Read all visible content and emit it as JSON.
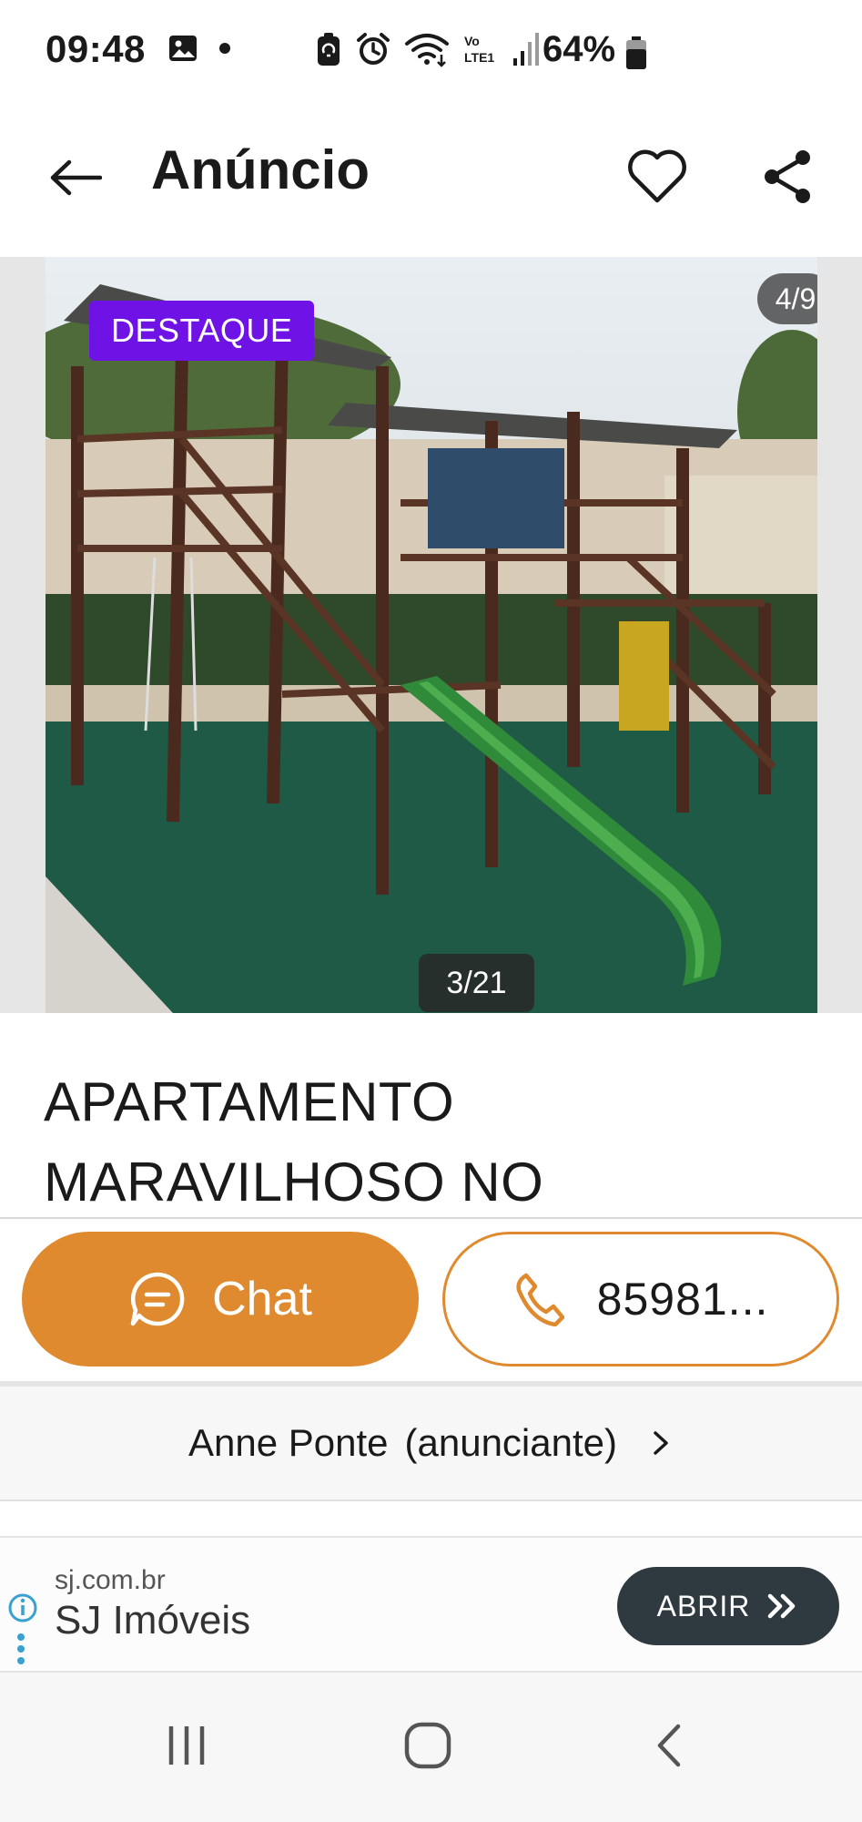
{
  "status_bar": {
    "time": "09:48",
    "battery": "64%",
    "icons": [
      "gallery-icon",
      "dot-icon",
      "battery-saver-icon",
      "alarm-icon",
      "wifi-icon",
      "volte-icon",
      "signal-icon",
      "battery-icon"
    ],
    "volte_label": "Vo\nLTE1"
  },
  "app_bar": {
    "title": "Anúncio",
    "icons": [
      "back-arrow-icon",
      "heart-icon",
      "share-icon"
    ]
  },
  "gallery": {
    "badge": "DESTAQUE",
    "ad_counter": "4/9",
    "photo_counter": "3/21",
    "badge_color": "#6e12e6"
  },
  "listing": {
    "title_line1": "APARTAMENTO",
    "title_line2": "MARAVILHOSO NO"
  },
  "actions": {
    "chat_label": "Chat",
    "phone_label": "85981...",
    "accent_color": "#e08a30"
  },
  "advertiser": {
    "name": "Anne Ponte",
    "role": "(anunciante)"
  },
  "sponsor": {
    "domain": "sj.com.br",
    "name": "SJ Imóveis",
    "button_label": "ABRIR"
  },
  "nav": {
    "icons": [
      "recent-apps-icon",
      "home-icon",
      "back-icon"
    ]
  }
}
